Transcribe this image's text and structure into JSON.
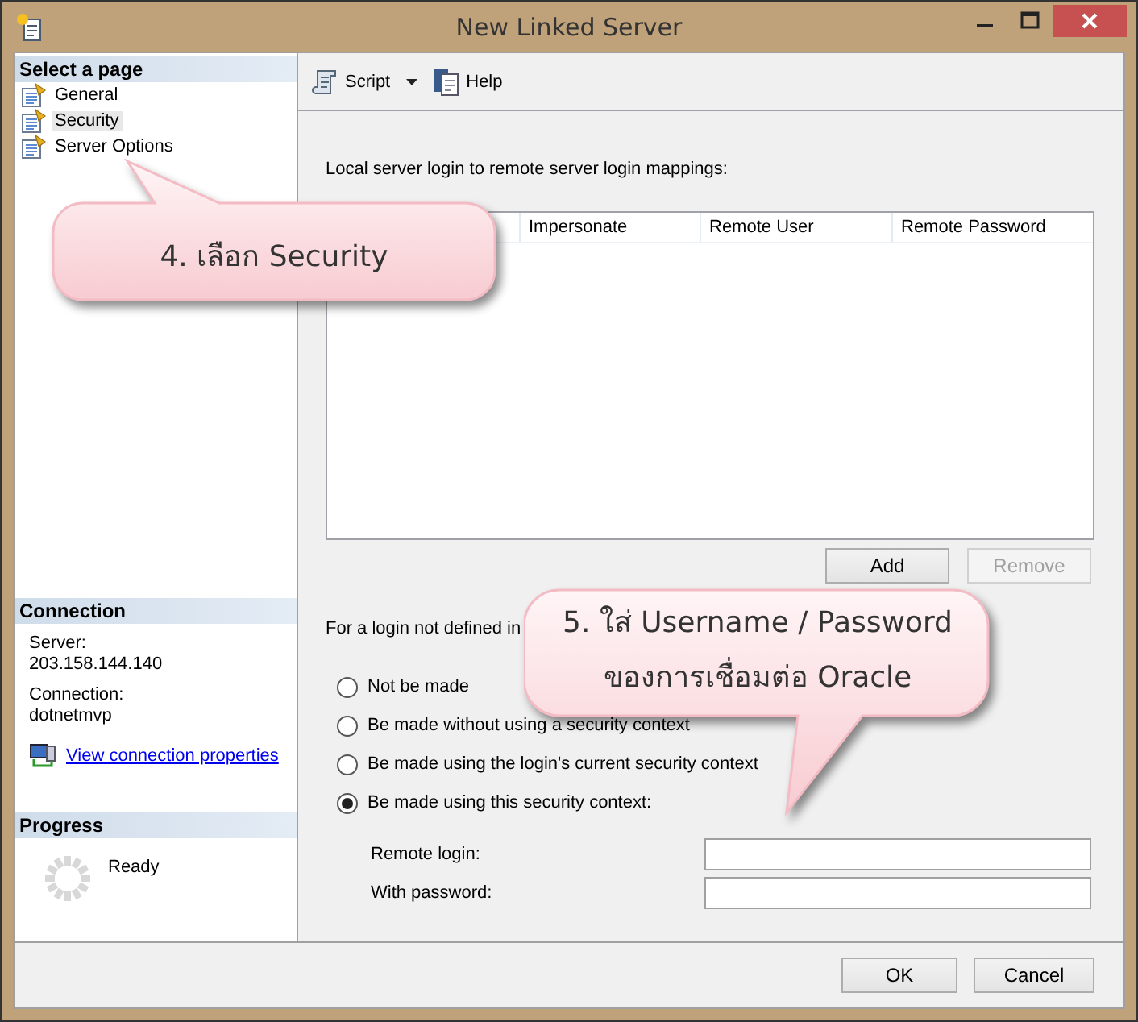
{
  "window": {
    "title": "New Linked Server"
  },
  "sidebar": {
    "header": "Select a page",
    "pages": [
      {
        "label": "General",
        "selected": false
      },
      {
        "label": "Security",
        "selected": true
      },
      {
        "label": "Server Options",
        "selected": false
      }
    ]
  },
  "connection": {
    "header": "Connection",
    "fields": [
      {
        "label": "Server:",
        "value": "203.158.144.140"
      },
      {
        "label": "Connection:",
        "value": "dotnetmvp"
      }
    ],
    "link": "View connection properties"
  },
  "progress": {
    "header": "Progress",
    "status": "Ready"
  },
  "toolbar": [
    {
      "label": "Script",
      "kind": "script"
    },
    {
      "label": "Help",
      "kind": "help"
    }
  ],
  "mappings": {
    "label": "Local server login to remote server login mappings:",
    "columns": [
      "Impersonate",
      "Remote User",
      "Remote Password"
    ],
    "buttons": [
      {
        "label": "Add",
        "disabled": false
      },
      {
        "label": "Remove",
        "disabled": true
      }
    ]
  },
  "fallback": {
    "label": "For a login not defined in",
    "options": [
      {
        "label": "Not be made",
        "selected": false
      },
      {
        "label": "Be made without using a security context",
        "selected": false
      },
      {
        "label": "Be made using the login's current security context",
        "selected": false
      },
      {
        "label": "Be made using this security context:",
        "selected": true
      }
    ]
  },
  "fields": [
    {
      "label": "Remote login:"
    },
    {
      "label": "With password:"
    }
  ],
  "buttons": [
    "OK",
    "Cancel"
  ],
  "callouts": [
    {
      "text": "4. เลือก Security",
      "kind": "up"
    },
    {
      "text": "5. ใส่ Username / Password\nของการเชื่อมต่อ Oracle",
      "kind": "down"
    }
  ]
}
